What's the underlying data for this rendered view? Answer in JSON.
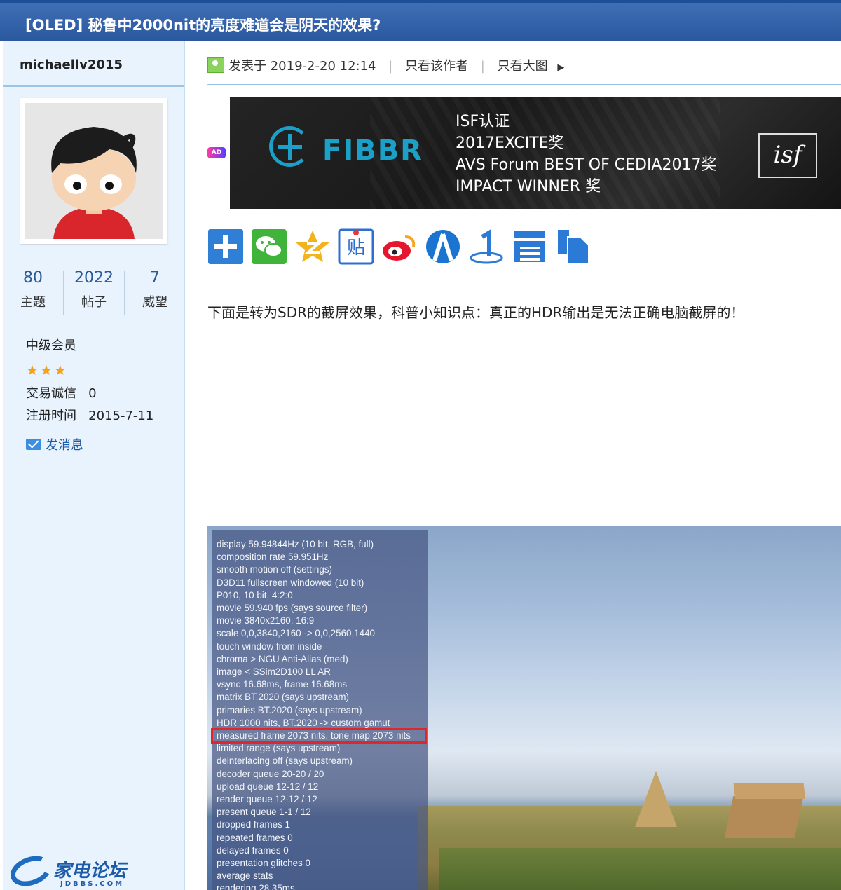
{
  "thread": {
    "title": "[OLED] 秘鲁中2000nit的亮度难道会是阴天的效果?"
  },
  "author": {
    "username": "michaellv2015",
    "stats": [
      {
        "value": "80",
        "label": "主题"
      },
      {
        "value": "2022",
        "label": "帖子"
      },
      {
        "value": "7",
        "label": "威望"
      }
    ],
    "level": "中级会员",
    "stars": 3,
    "trade_label": "交易诚信",
    "trade_value": "0",
    "reg_label": "注册时间",
    "reg_value": "2015-7-11",
    "pm_label": "发消息"
  },
  "post": {
    "posted_prefix": "发表于",
    "posted_time": "2019-2-20 12:14",
    "only_author": "只看该作者",
    "only_images": "只看大图",
    "body": "下面是转为SDR的截屏效果，科普小知识点：真正的HDR输出是无法正确电脑截屏的！"
  },
  "ad": {
    "badge": "AD",
    "brand": "FIBBR",
    "lines": [
      "ISF认证",
      "2017EXCITE奖",
      "AVS Forum BEST OF CEDIA2017奖",
      "IMPACT WINNER 奖"
    ],
    "isf": "isf"
  },
  "share_icons": [
    "plus-icon",
    "wechat-icon",
    "qzone-icon",
    "tieba-icon",
    "weibo-icon",
    "renren-icon",
    "kaixin-icon",
    "print-icon",
    "copy-icon"
  ],
  "screenshot_overlay": {
    "highlight_index": 15,
    "highlight_color": "#e0262a",
    "lines": [
      "display 59.94844Hz  (10 bit, RGB, full)",
      "composition rate 59.951Hz",
      "smooth motion off (settings)",
      "D3D11 fullscreen windowed (10 bit)",
      "P010, 10 bit, 4:2:0",
      "movie 59.940 fps  (says source filter)",
      "movie 3840x2160, 16:9",
      "scale 0,0,3840,2160 -> 0,0,2560,1440",
      "touch window from inside",
      "chroma > NGU Anti-Alias (med)",
      "image < SSim2D100 LL AR",
      "vsync 16.68ms, frame 16.68ms",
      "matrix BT.2020 (says upstream)",
      "primaries BT.2020 (says upstream)",
      "HDR 1000 nits, BT.2020 -> custom gamut",
      "measured frame 2073 nits, tone map 2073 nits",
      "limited range (says upstream)",
      "deinterlacing off (says upstream)",
      "decoder queue 20-20 / 20",
      "upload queue 12-12 / 12",
      "render queue 12-12 / 12",
      "present queue 1-1 / 12",
      "dropped frames 1",
      "repeated frames 0",
      "delayed frames 0",
      "presentation glitches 0",
      "average stats",
      "   rendering 28.35ms"
    ]
  },
  "site_logo": {
    "name": "家电论坛",
    "domain": "JDBBS.COM"
  },
  "colors": {
    "title_bar": "#2b589f",
    "sidebar_bg": "#e8f3fd",
    "accent_blue": "#1d5ba8",
    "star": "#f4a21c"
  }
}
